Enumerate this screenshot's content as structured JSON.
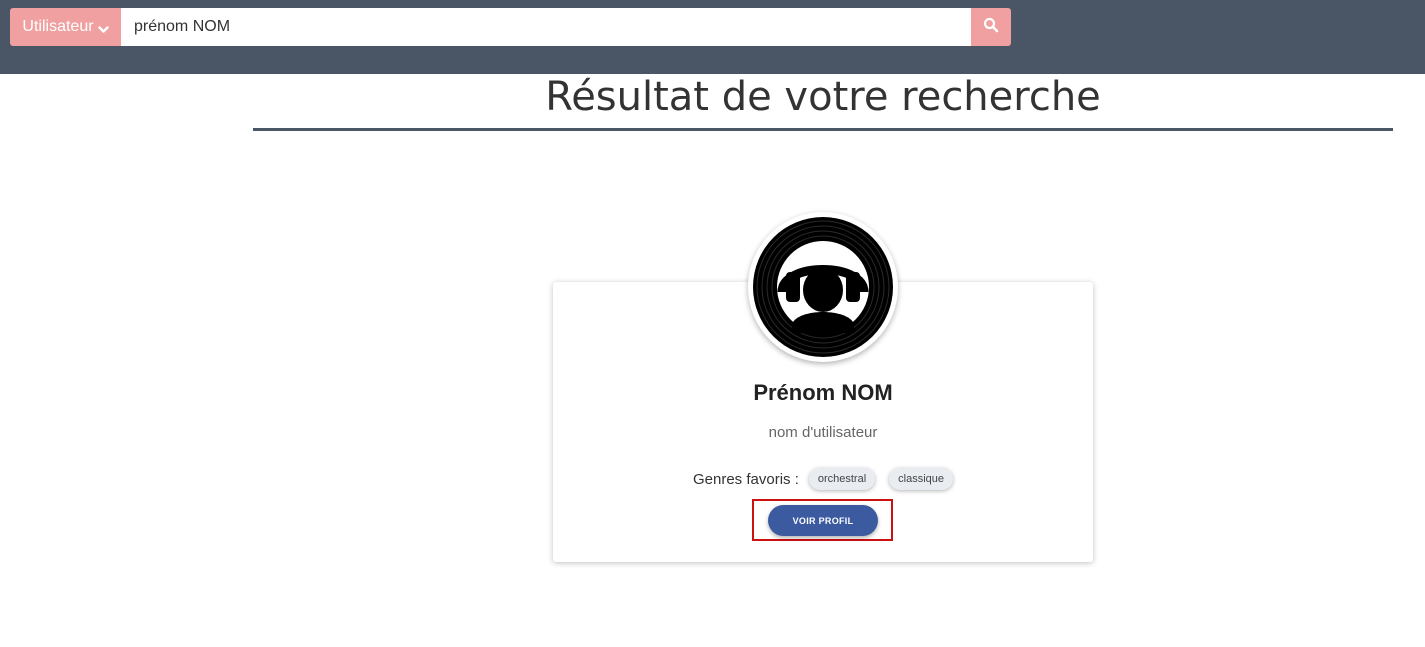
{
  "header": {
    "search_type_label": "Utilisateur",
    "search_type_icon": "chevron-down-icon",
    "search_value": "prénom NOM",
    "search_button_icon": "search-icon",
    "accent_color": "#f0a0a0",
    "bar_color": "#4a5566"
  },
  "main": {
    "title": "Résultat de votre recherche"
  },
  "result_card": {
    "avatar_icon": "vinyl-headphones-icon",
    "name": "Prénom NOM",
    "username": "nom d'utilisateur",
    "genres_label": "Genres favoris :",
    "genres": [
      "orchestral",
      "classique"
    ],
    "view_button_label": "VOIR PROFIL",
    "button_color": "#3b5aa0"
  }
}
